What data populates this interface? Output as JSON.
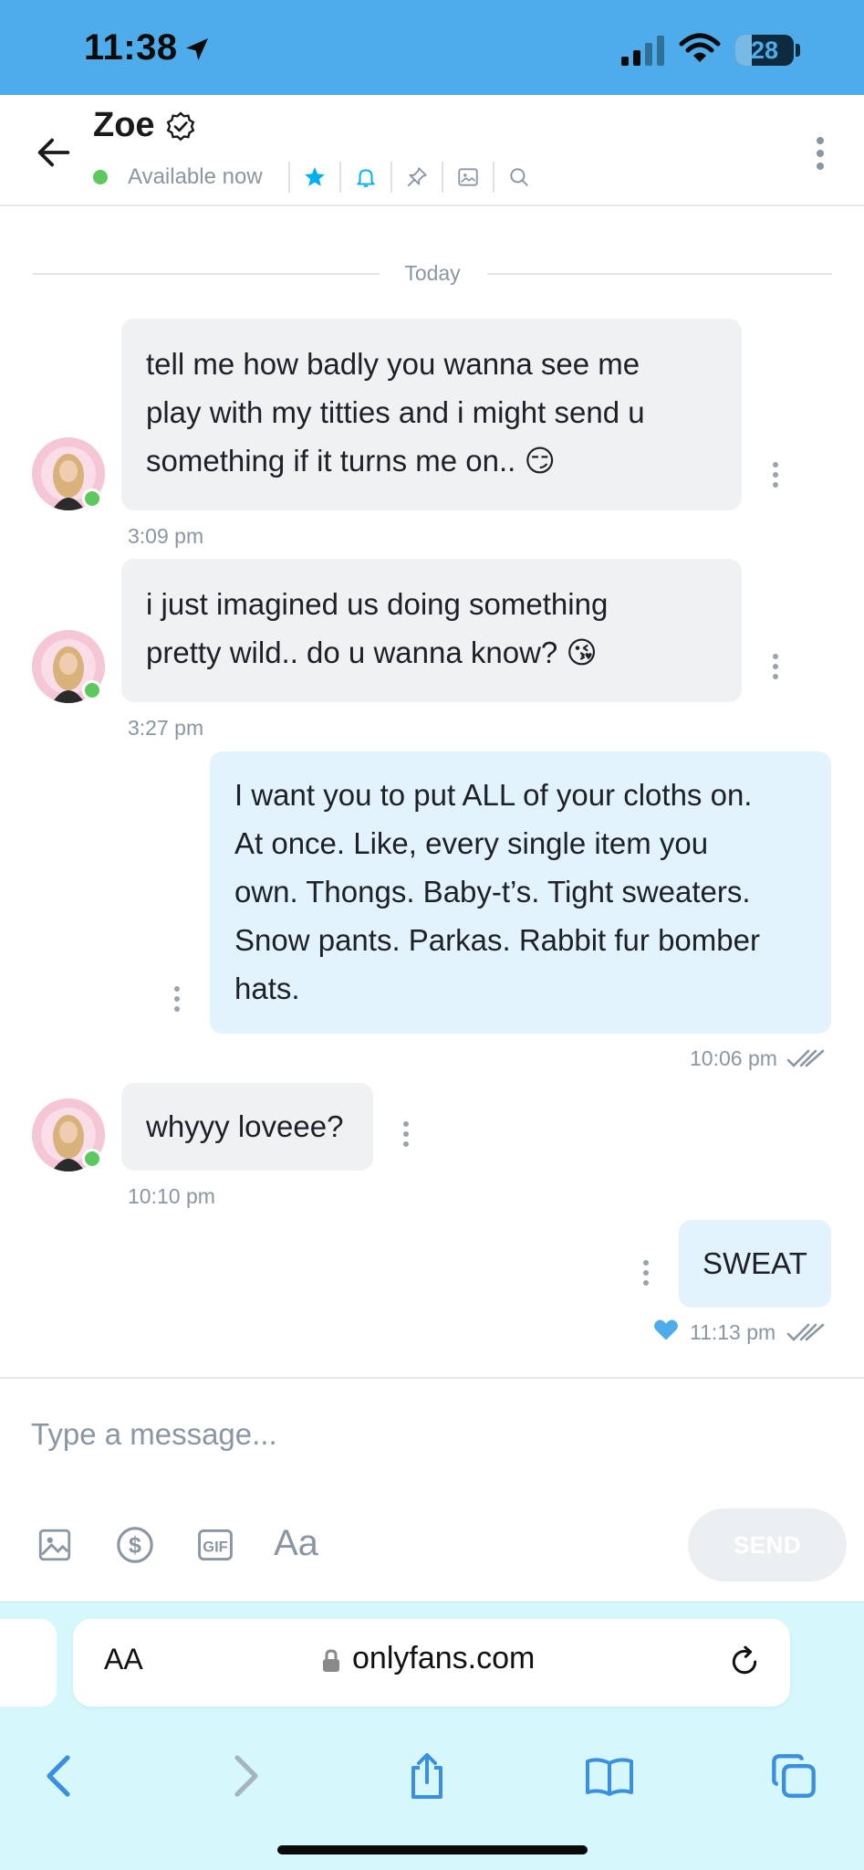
{
  "status_bar": {
    "time": "11:38",
    "battery": "28",
    "battery_level": 0.28
  },
  "header": {
    "name": "Zoe",
    "status": "Available now"
  },
  "chat": {
    "day_label": "Today",
    "messages": [
      {
        "direction": "in",
        "text": "tell me how badly you wanna see me\nplay with my titties and i might send u\nsomething if it turns me on.. 😏",
        "time": "3:09 pm"
      },
      {
        "direction": "in",
        "text": "i just imagined us doing something\npretty wild.. do u wanna know? 😘",
        "time": "3:27 pm"
      },
      {
        "direction": "out",
        "text": "I want you to put ALL of your cloths on.\nAt once. Like, every single item you\nown. Thongs. Baby-t’s. Tight sweaters.\nSnow pants. Parkas. Rabbit fur bomber\nhats.",
        "time": "10:06 pm"
      },
      {
        "direction": "in",
        "text": "whyyy loveee?",
        "time": "10:10 pm"
      },
      {
        "direction": "out",
        "text": "SWEAT",
        "time": "11:13 pm",
        "liked": true
      }
    ]
  },
  "composer": {
    "placeholder": "Type a message...",
    "font_tool_label": "Aa",
    "send_label": "SEND"
  },
  "browser": {
    "aa_label": "AA",
    "url": "onlyfans.com"
  },
  "colors": {
    "status_bar_bg": "#4facea",
    "online": "#5cc85d",
    "accent": "#00aff0",
    "incoming_bubble": "#f0f1f3",
    "outgoing_bubble": "#e3f3fd",
    "safari_bg": "#d6f8fd"
  }
}
